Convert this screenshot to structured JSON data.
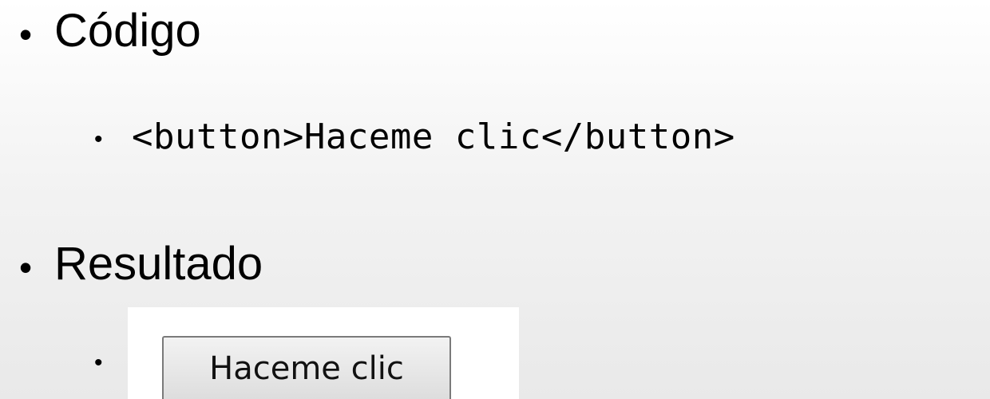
{
  "slide": {
    "bullet_glyph": "•",
    "items": [
      {
        "label": "Código",
        "subitems": [
          {
            "code": "<button>Haceme clic</button>"
          }
        ]
      },
      {
        "label": "Resultado",
        "subitems": [
          {
            "button_label": "Haceme clic"
          }
        ]
      }
    ]
  },
  "colors": {
    "background_top": "#ffffff",
    "background_bottom": "#e9e9e9",
    "panel": "#ffffff",
    "button_border": "#7a7a7a"
  }
}
